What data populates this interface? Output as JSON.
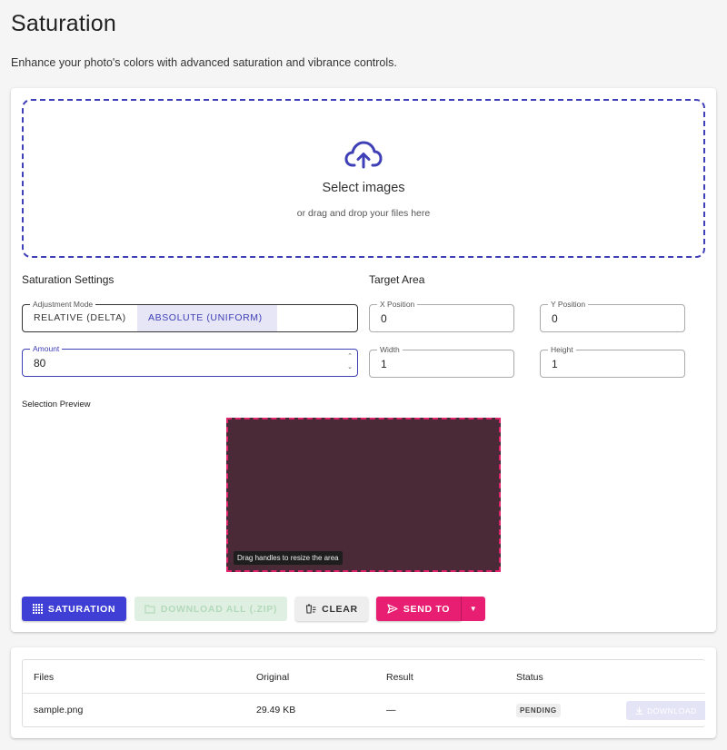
{
  "page": {
    "title": "Saturation",
    "subtitle": "Enhance your photo's colors with advanced saturation and vibrance controls."
  },
  "dropzone": {
    "icon": "cloud-upload-icon",
    "title": "Select images",
    "subtitle": "or drag and drop your files here",
    "accent": "#3f3fb7"
  },
  "settings": {
    "heading": "Saturation Settings",
    "mode_label": "Adjustment Mode",
    "mode_options": [
      "RELATIVE (DELTA)",
      "ABSOLUTE (UNIFORM)"
    ],
    "mode_selected": "ABSOLUTE (UNIFORM)",
    "amount_label": "Amount",
    "amount_value": "80"
  },
  "target": {
    "heading": "Target Area",
    "x_label": "X Position",
    "x_value": "0",
    "y_label": "Y Position",
    "y_value": "0",
    "width_label": "Width",
    "width_value": "1",
    "height_label": "Height",
    "height_value": "1"
  },
  "preview": {
    "label": "Selection Preview",
    "hint": "Drag handles to resize the area",
    "fill_color": "#4a2a36",
    "border_color": "#e0246d"
  },
  "actions": {
    "saturation": "SATURATION",
    "download_all": "DOWNLOAD ALL (.ZIP)",
    "clear": "CLEAR",
    "send_to": "SEND TO",
    "primary_color": "#3f3fd6",
    "send_color": "#e81e72"
  },
  "files_table": {
    "columns": [
      "Files",
      "Original",
      "Result",
      "Status"
    ],
    "rows": [
      {
        "file": "sample.png",
        "original": "29.49 KB",
        "result": "—",
        "status": "PENDING",
        "action": "DOWNLOAD"
      }
    ]
  }
}
